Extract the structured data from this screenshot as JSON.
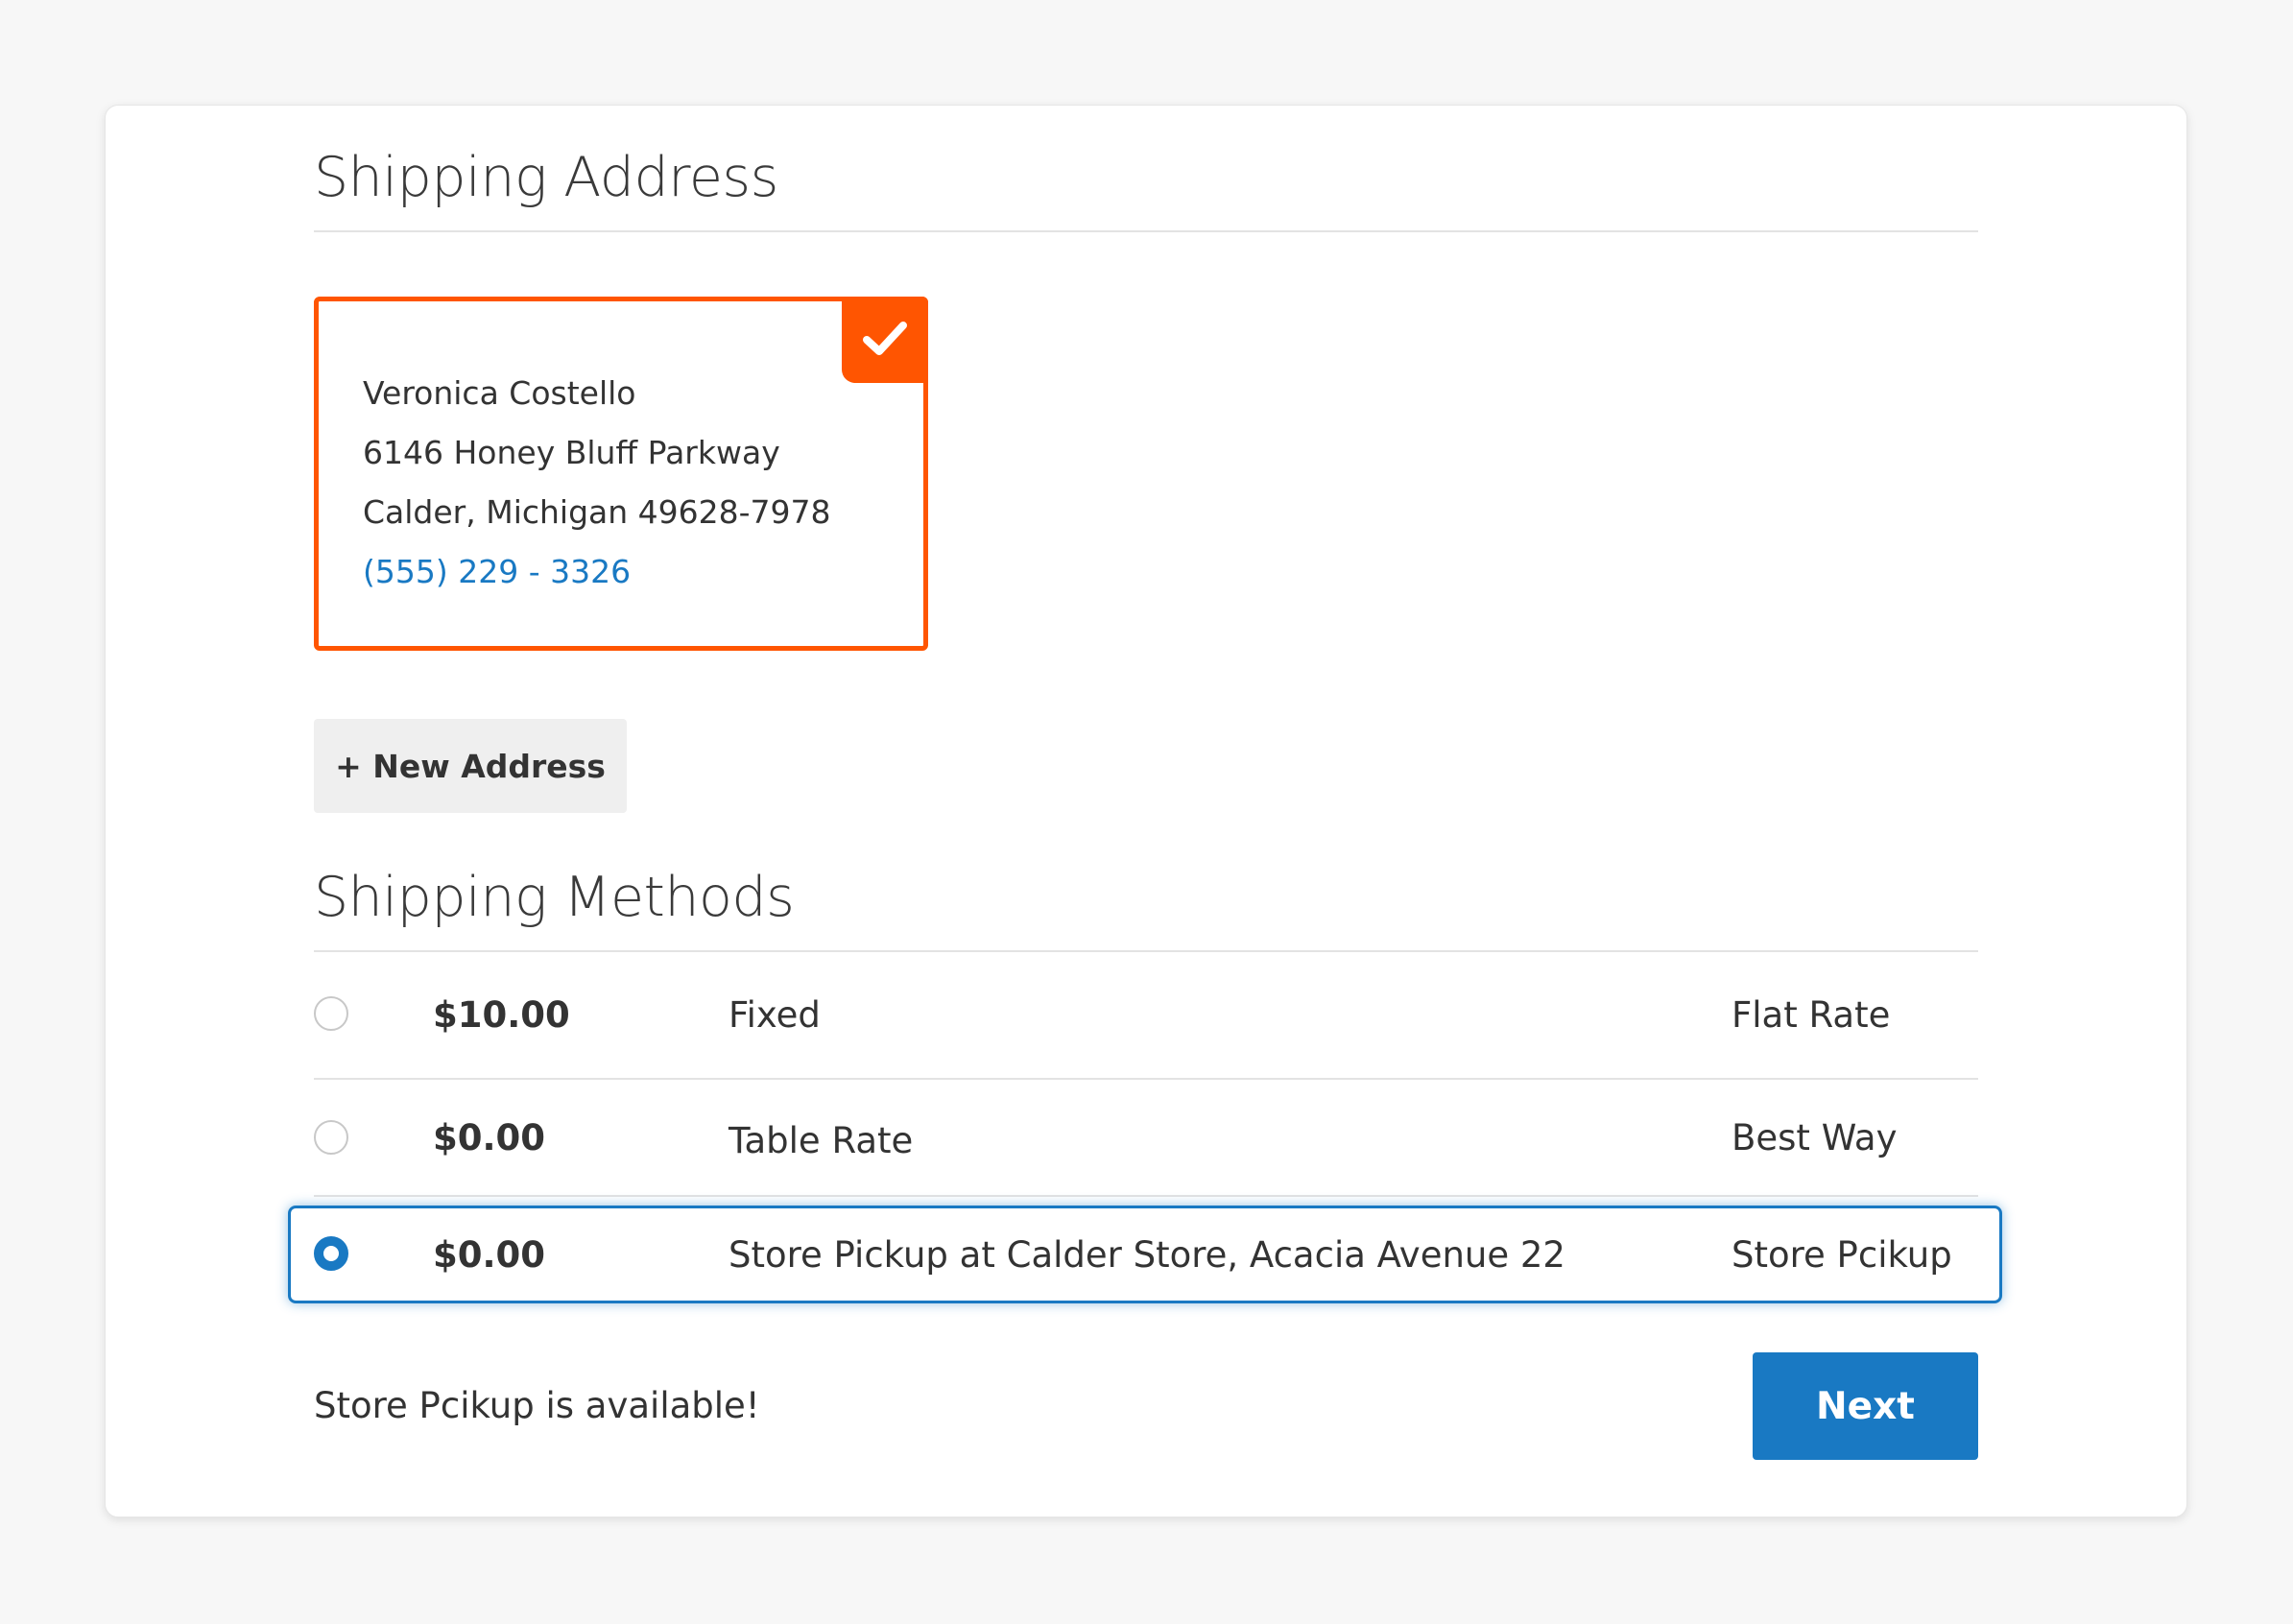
{
  "shipping_address": {
    "title": "Shipping Address",
    "selected_address": {
      "name": "Veronica Costello",
      "street": "6146 Honey Bluff Parkway",
      "city_line": "Calder, Michigan 49628-7978",
      "phone": "(555) 229 - 3326",
      "selected": true
    },
    "new_address_label": "+ New Address"
  },
  "shipping_methods": {
    "title": "Shipping Methods",
    "rows": [
      {
        "price": "$10.00",
        "method": "Fixed",
        "carrier": "Flat Rate",
        "selected": false
      },
      {
        "price": "$0.00",
        "method": "Table Rate",
        "carrier": "Best Way",
        "selected": false
      },
      {
        "price": "$0.00",
        "method": "Store Pickup at Calder Store, Acacia Avenue 22",
        "carrier": "Store Pcikup",
        "selected": true
      }
    ]
  },
  "footer": {
    "status_message": "Store Pcikup is available!",
    "next_label": "Next"
  },
  "colors": {
    "accent_orange": "#ff5501",
    "primary_blue": "#1979c3",
    "text": "#333333",
    "phone_link": "#1979c3"
  },
  "icons": {
    "selected_badge": "checkmark-icon",
    "radio": "radio-button-icon"
  }
}
